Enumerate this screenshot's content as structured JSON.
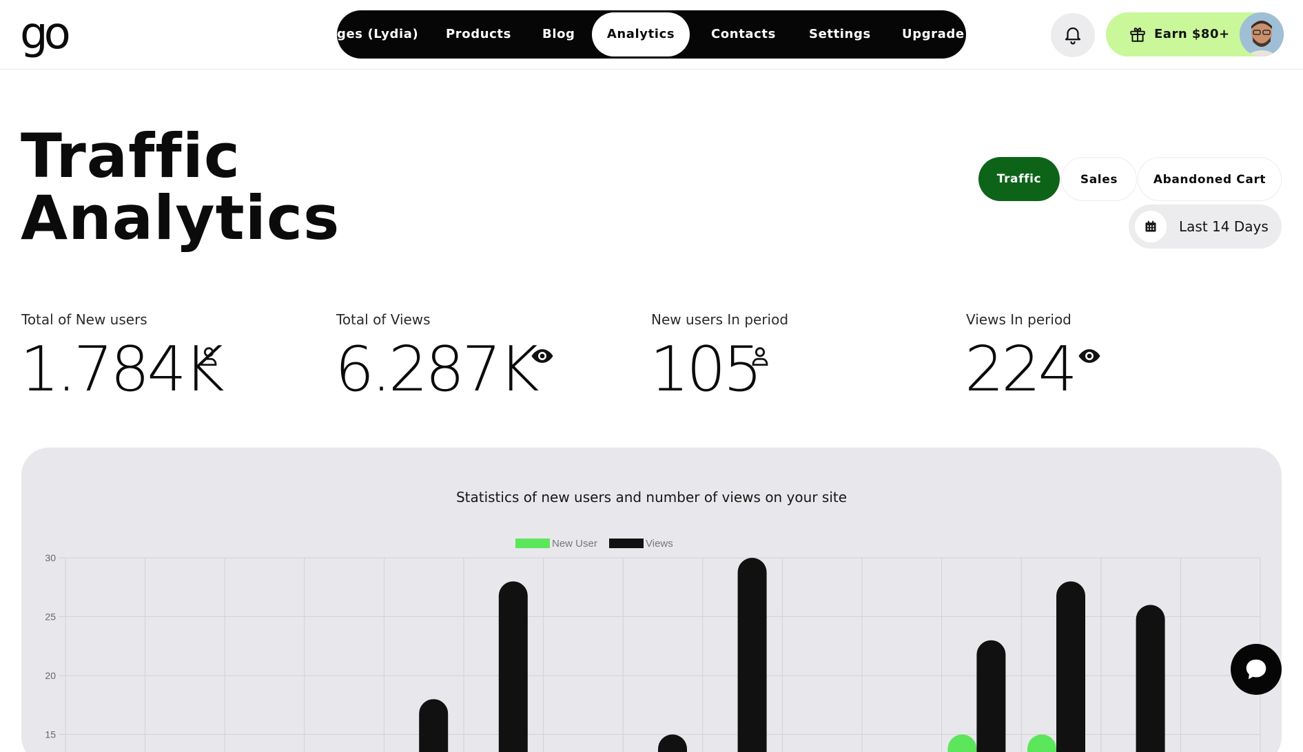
{
  "header": {
    "logo_text": "go",
    "nav": [
      {
        "label": "ges (Lydia)",
        "active": false
      },
      {
        "label": "Products",
        "active": false
      },
      {
        "label": "Blog",
        "active": false
      },
      {
        "label": "Analytics",
        "active": true
      },
      {
        "label": "Contacts",
        "active": false
      },
      {
        "label": "Settings",
        "active": false
      },
      {
        "label": "Upgrade S",
        "active": false
      }
    ],
    "notification_icon": "bell-icon",
    "earn_label": "Earn $80+",
    "earn_icon": "gift-icon"
  },
  "page": {
    "title_line1": "Traffic",
    "title_line2": "Analytics"
  },
  "tabs": {
    "traffic": "Traffic",
    "sales": "Sales",
    "abandoned_cart": "Abandoned Cart",
    "active": "traffic",
    "accent": "#0d6419"
  },
  "date_range": {
    "label": "Last 14 Days",
    "icon": "calendar-icon"
  },
  "stats": [
    {
      "label": "Total of New users",
      "value": "1.784K",
      "icon": "user-icon"
    },
    {
      "label": "Total of Views",
      "value": "6.287K",
      "icon": "eye-icon"
    },
    {
      "label": "New users In period",
      "value": "105",
      "icon": "user-icon"
    },
    {
      "label": "Views In period",
      "value": "224",
      "icon": "eye-icon"
    }
  ],
  "chart": {
    "title": "Statistics of new users and number of views on your site"
  },
  "chart_data": {
    "type": "bar",
    "title": "Statistics of new users and number of views on your site",
    "legend_position": "top",
    "grid": true,
    "y_ticks": [
      30,
      25,
      20,
      15
    ],
    "ylim_visible": [
      14.5,
      30
    ],
    "category_count": 15,
    "series": [
      {
        "name": "New User",
        "color": "#5ce65c",
        "values": [
          null,
          null,
          null,
          null,
          null,
          null,
          null,
          null,
          null,
          null,
          null,
          15,
          15,
          null,
          null
        ]
      },
      {
        "name": "Views",
        "color": "#111111",
        "values": [
          null,
          null,
          null,
          null,
          18,
          28,
          null,
          15,
          30,
          null,
          null,
          23,
          28,
          26,
          null
        ]
      }
    ]
  },
  "chat": {
    "icon": "chat-bubble-icon"
  }
}
